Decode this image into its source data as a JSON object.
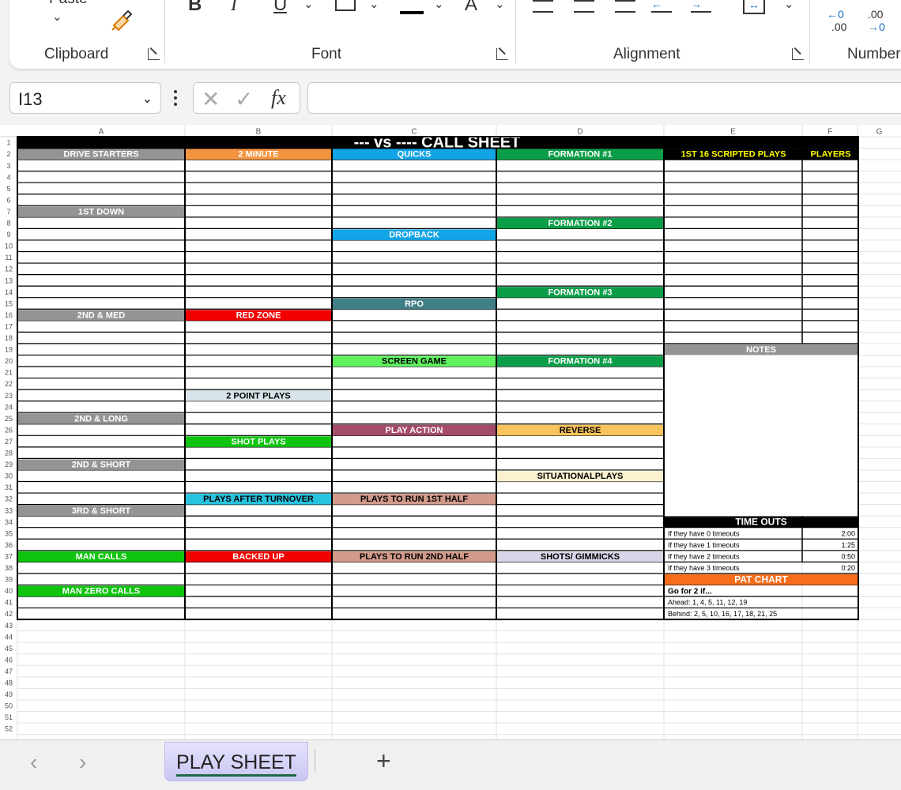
{
  "ribbon": {
    "paste_label": "Paste",
    "groups": {
      "clipboard": "Clipboard",
      "font": "Font",
      "alignment": "Alignment",
      "number": "Number"
    },
    "font_buttons": {
      "bold": "B",
      "italic": "I",
      "underline": "U",
      "font_color": "A"
    },
    "number_buttons": {
      "increase_decimal_top": "←0",
      "increase_decimal_bottom": ".00",
      "decrease_decimal_top": ".00",
      "decrease_decimal_bottom": "→0"
    }
  },
  "formula_bar": {
    "name_box": "I13",
    "formula": "",
    "fx_label": "fx"
  },
  "sheet": {
    "title": "--- vs ---- CALL SHEET",
    "columns": [
      "A",
      "B",
      "C",
      "D",
      "E",
      "F",
      "G"
    ],
    "row_count": 52,
    "headers": [
      {
        "text": "DRIVE STARTERS",
        "col": 0,
        "row": 2,
        "bg": "#949494",
        "fg": "#ffffff"
      },
      {
        "text": "1ST DOWN",
        "col": 0,
        "row": 7,
        "bg": "#949494",
        "fg": "#ffffff"
      },
      {
        "text": "2ND & MED",
        "col": 0,
        "row": 16,
        "bg": "#949494",
        "fg": "#ffffff"
      },
      {
        "text": "2ND & LONG",
        "col": 0,
        "row": 25,
        "bg": "#949494",
        "fg": "#ffffff"
      },
      {
        "text": "2ND & SHORT",
        "col": 0,
        "row": 29,
        "bg": "#949494",
        "fg": "#ffffff"
      },
      {
        "text": "3RD & SHORT",
        "col": 0,
        "row": 33,
        "bg": "#949494",
        "fg": "#ffffff"
      },
      {
        "text": "MAN CALLS",
        "col": 0,
        "row": 37,
        "bg": "#0ec40e",
        "fg": "#ffffff"
      },
      {
        "text": "MAN ZERO CALLS",
        "col": 0,
        "row": 40,
        "bg": "#0ec40e",
        "fg": "#ffffff"
      },
      {
        "text": "2 MINUTE",
        "col": 1,
        "row": 2,
        "bg": "#f59440",
        "fg": "#ffffff"
      },
      {
        "text": "RED ZONE",
        "col": 1,
        "row": 16,
        "bg": "#f20000",
        "fg": "#ffffff"
      },
      {
        "text": "2 POINT PLAYS",
        "col": 1,
        "row": 23,
        "bg": "#d9e4ea",
        "fg": "#000000"
      },
      {
        "text": "SHOT PLAYS",
        "col": 1,
        "row": 27,
        "bg": "#0ec40e",
        "fg": "#ffffff"
      },
      {
        "text": "PLAYS AFTER TURNOVER",
        "col": 1,
        "row": 32,
        "bg": "#27c3df",
        "fg": "#000000"
      },
      {
        "text": "BACKED UP",
        "col": 1,
        "row": 37,
        "bg": "#f20000",
        "fg": "#ffffff"
      },
      {
        "text": "QUICKS",
        "col": 2,
        "row": 2,
        "bg": "#11a4e6",
        "fg": "#ffffff"
      },
      {
        "text": "DROPBACK",
        "col": 2,
        "row": 9,
        "bg": "#11a4e6",
        "fg": "#ffffff"
      },
      {
        "text": "RPO",
        "col": 2,
        "row": 15,
        "bg": "#3f7f86",
        "fg": "#ffffff"
      },
      {
        "text": "SCREEN GAME",
        "col": 2,
        "row": 20,
        "bg": "#5ff15f",
        "fg": "#000000"
      },
      {
        "text": "PLAY ACTION",
        "col": 2,
        "row": 26,
        "bg": "#a44a6a",
        "fg": "#ffffff"
      },
      {
        "text": "PLAYS TO RUN 1ST HALF",
        "col": 2,
        "row": 32,
        "bg": "#d29a8b",
        "fg": "#000000"
      },
      {
        "text": "PLAYS TO RUN 2ND HALF",
        "col": 2,
        "row": 37,
        "bg": "#d29a8b",
        "fg": "#000000"
      },
      {
        "text": "FORMATION #1",
        "col": 3,
        "row": 2,
        "bg": "#0b9e48",
        "fg": "#ffffff"
      },
      {
        "text": "FORMATION #2",
        "col": 3,
        "row": 8,
        "bg": "#0b9e48",
        "fg": "#ffffff"
      },
      {
        "text": "FORMATION #3",
        "col": 3,
        "row": 14,
        "bg": "#0b9e48",
        "fg": "#ffffff"
      },
      {
        "text": "FORMATION #4",
        "col": 3,
        "row": 20,
        "bg": "#0b9e48",
        "fg": "#ffffff"
      },
      {
        "text": "REVERSE",
        "col": 3,
        "row": 26,
        "bg": "#f8c35c",
        "fg": "#000000"
      },
      {
        "text": "SITUATIONALPLAYS",
        "col": 3,
        "row": 30,
        "bg": "#fbf0cf",
        "fg": "#000000"
      },
      {
        "text": "SHOTS/ GIMMICKS",
        "col": 3,
        "row": 37,
        "bg": "#d6d6e8",
        "fg": "#000000"
      }
    ],
    "scripted": {
      "title": "1ST 16 SCRIPTED PLAYS",
      "players": "PLAYERS",
      "fg": "#ffff00"
    },
    "notes": {
      "title": "NOTES",
      "bg": "#949494"
    },
    "timeouts": {
      "title": "TIME OUTS",
      "rows": [
        {
          "label": "If they have 0 timeouts",
          "value": "2:00"
        },
        {
          "label": "If they have 1 timeouts",
          "value": "1:25"
        },
        {
          "label": "If they have 2 timeouts",
          "value": "0:50"
        },
        {
          "label": "If they have 3 timeouts",
          "value": "0:20"
        }
      ]
    },
    "pat": {
      "title": "PAT CHART",
      "bg": "#f76d1a",
      "lines": [
        "Go for 2 if...",
        "Ahead: 1, 4, 5, 11, 12, 19",
        "Behind: 2, 5, 10, 16, 17, 18, 21, 25"
      ]
    }
  },
  "tabs": {
    "active": "PLAY SHEET"
  }
}
